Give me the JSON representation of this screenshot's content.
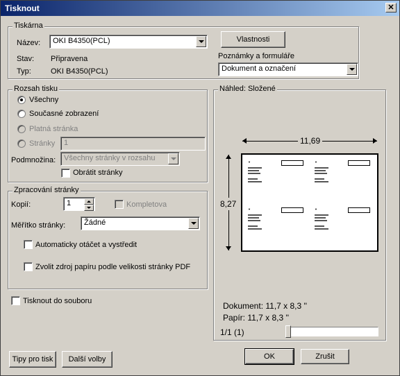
{
  "window": {
    "title": "Tisknout",
    "close_glyph": "✕"
  },
  "printer": {
    "group_label": "Tiskárna",
    "name_label": "Název:",
    "name_value": "OKI B4350(PCL)",
    "status_label": "Stav:",
    "status_value": "Připravena",
    "type_label": "Typ:",
    "type_value": "OKI B4350(PCL)",
    "properties_button": "Vlastnosti",
    "comments_label": "Poznámky a formuláře",
    "comments_value": "Dokument a označení"
  },
  "range": {
    "group_label": "Rozsah tisku",
    "all": "Všechny",
    "current_view": "Současné zobrazení",
    "current_page": "Platná stránka",
    "pages": "Stránky",
    "pages_value": "1",
    "subset_label": "Podmnožina:",
    "subset_value": "Všechny stránky v rozsahu",
    "reverse_pages": "Obrátit stránky"
  },
  "handling": {
    "group_label": "Zpracování stránky",
    "copies_label": "Kopií:",
    "copies_value": "1",
    "collate": "Kompletova",
    "scaling_label": "Měřítko stránky:",
    "scaling_value": "Žádné",
    "auto_rotate": "Automaticky otáčet a vystředit",
    "choose_source": "Zvolit zdroj papíru podle velikosti stránky PDF"
  },
  "print_to_file": "Tisknout do souboru",
  "preview": {
    "group_label": "Náhled: Složené",
    "width_dim": "11,69",
    "height_dim": "8,27",
    "document_size": "Dokument: 11,7 x 8,3 ''",
    "paper_size": "Papír: 11,7 x 8,3 ''",
    "page_counter": "1/1 (1)",
    "slider_position": 0.0
  },
  "buttons": {
    "tips": "Tipy pro tisk",
    "more_options": "Další volby",
    "ok": "OK",
    "cancel": "Zrušit"
  },
  "colors": {
    "titlebar_start": "#0a246a",
    "titlebar_end": "#a6caf0",
    "face": "#d4d0c8"
  }
}
